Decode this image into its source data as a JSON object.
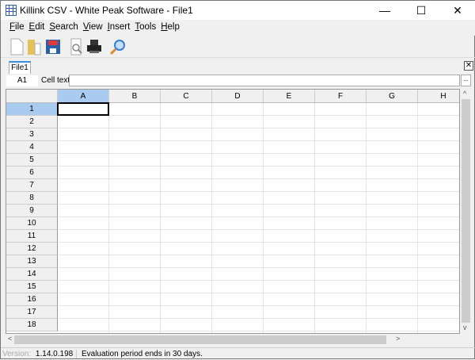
{
  "window": {
    "title": "Killink CSV - White Peak Software - File1",
    "minimize": "—",
    "maximize": "☐",
    "close": "✕"
  },
  "menu": [
    {
      "key": "F",
      "rest": "ile"
    },
    {
      "key": "E",
      "rest": "dit"
    },
    {
      "key": "S",
      "rest": "earch"
    },
    {
      "key": "V",
      "rest": "iew"
    },
    {
      "key": "I",
      "rest": "nsert"
    },
    {
      "key": "T",
      "rest": "ools"
    },
    {
      "key": "H",
      "rest": "elp"
    }
  ],
  "toolbar": [
    "new-file-icon",
    "open-folder-icon",
    "save-icon",
    "print-preview-icon",
    "print-icon",
    "search-icon"
  ],
  "tabs": {
    "active": "File1",
    "close": "✕"
  },
  "formula": {
    "cell_ref": "A1",
    "label": "Cell text:",
    "value": "",
    "button": "..."
  },
  "grid": {
    "columns": [
      "A",
      "B",
      "C",
      "D",
      "E",
      "F",
      "G",
      "H"
    ],
    "rows": [
      "1",
      "2",
      "3",
      "4",
      "5",
      "6",
      "7",
      "8",
      "9",
      "10",
      "11",
      "12",
      "13",
      "14",
      "15",
      "16",
      "17",
      "18"
    ],
    "selected": "A1"
  },
  "scroll": {
    "up": "^",
    "down": "v",
    "left": "<",
    "right": ">"
  },
  "status": {
    "version_label": "Version:",
    "version": "1.14.0.198",
    "message": "Evaluation period ends in 30 days."
  }
}
